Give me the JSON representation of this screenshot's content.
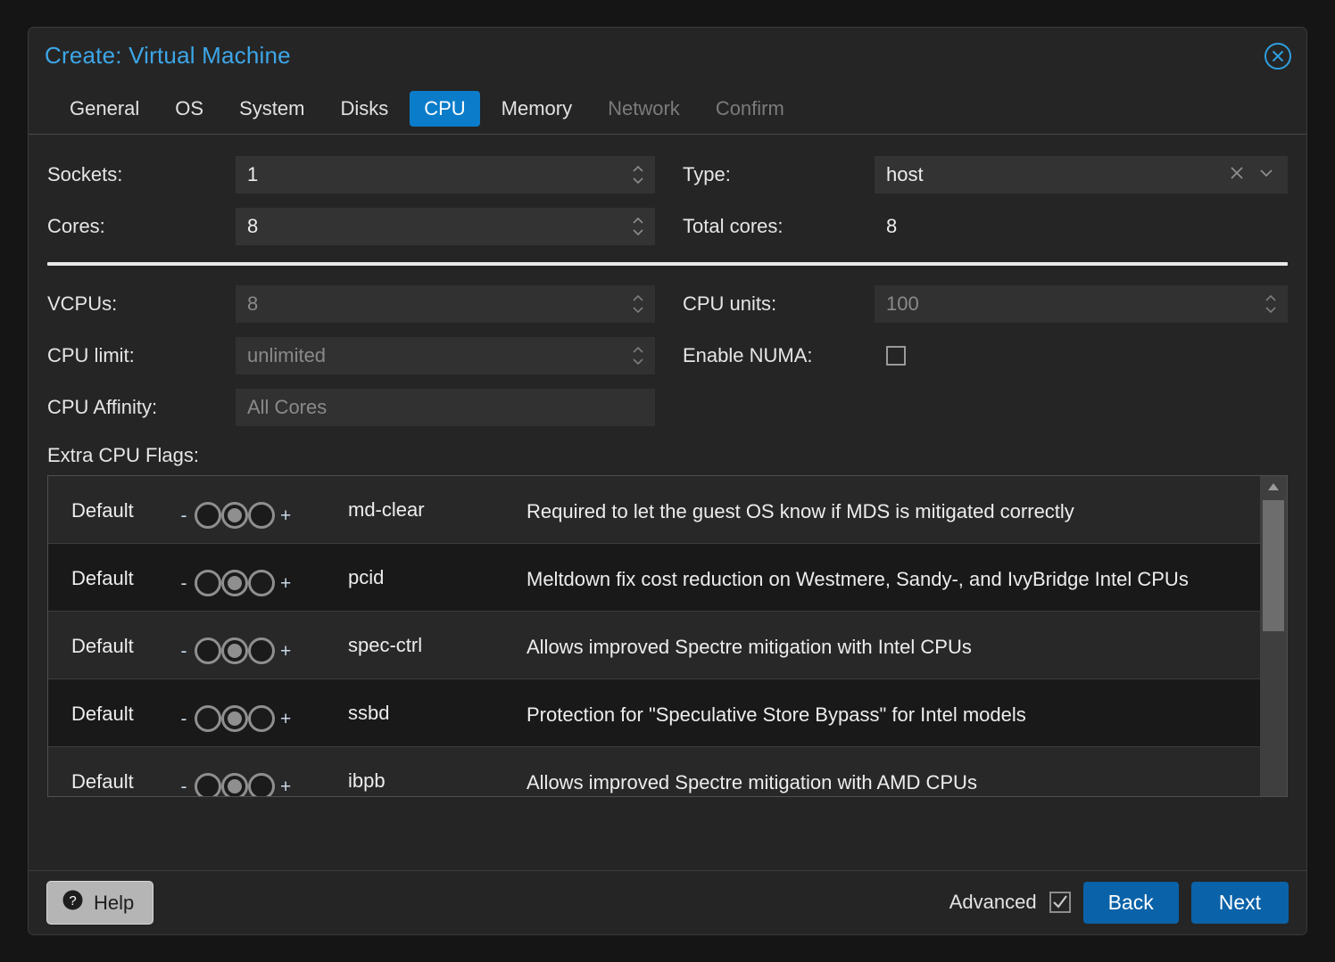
{
  "window": {
    "title": "Create: Virtual Machine",
    "close_icon": "close-circle-icon",
    "accent_blue": "#3da6e8",
    "tab_active_blue": "#0a7cca",
    "button_blue": "#0a62a8"
  },
  "tabs": [
    {
      "label": "General",
      "state": "enabled"
    },
    {
      "label": "OS",
      "state": "enabled"
    },
    {
      "label": "System",
      "state": "enabled"
    },
    {
      "label": "Disks",
      "state": "enabled"
    },
    {
      "label": "CPU",
      "state": "active"
    },
    {
      "label": "Memory",
      "state": "enabled"
    },
    {
      "label": "Network",
      "state": "disabled"
    },
    {
      "label": "Confirm",
      "state": "disabled"
    }
  ],
  "form": {
    "basic": {
      "sockets": {
        "label": "Sockets:",
        "value": "1",
        "spinner_icon": "spinner-up-down-icon"
      },
      "cores": {
        "label": "Cores:",
        "value": "8",
        "spinner_icon": "spinner-up-down-icon"
      },
      "type": {
        "label": "Type:",
        "value": "host",
        "clear_icon": "clear-x-icon",
        "expand_icon": "chevron-down-icon"
      },
      "total_cores": {
        "label": "Total cores:",
        "value": "8"
      }
    },
    "advanced": {
      "vcpus": {
        "label": "VCPUs:",
        "placeholder": "8",
        "spinner_icon": "spinner-up-down-icon"
      },
      "cpu_limit": {
        "label": "CPU limit:",
        "placeholder": "unlimited",
        "spinner_icon": "spinner-up-down-icon"
      },
      "cpu_affinity": {
        "label": "CPU Affinity:",
        "placeholder": "All Cores"
      },
      "cpu_units": {
        "label": "CPU units:",
        "placeholder": "100",
        "spinner_icon": "spinner-up-down-icon"
      },
      "enable_numa": {
        "label": "Enable NUMA:",
        "checked": false,
        "checkbox_icon": "checkbox-unchecked-icon"
      }
    }
  },
  "extra_cpu_flags": {
    "label": "Extra CPU Flags:",
    "minus_sign": "-",
    "plus_sign": "+",
    "rows": [
      {
        "state_label": "Default",
        "selected": "default",
        "flag": "md-clear",
        "description": "Required to let the guest OS know if MDS is mitigated correctly"
      },
      {
        "state_label": "Default",
        "selected": "default",
        "flag": "pcid",
        "description": "Meltdown fix cost reduction on Westmere, Sandy-, and IvyBridge Intel CPUs"
      },
      {
        "state_label": "Default",
        "selected": "default",
        "flag": "spec-ctrl",
        "description": "Allows improved Spectre mitigation with Intel CPUs"
      },
      {
        "state_label": "Default",
        "selected": "default",
        "flag": "ssbd",
        "description": "Protection for \"Speculative Store Bypass\" for Intel models"
      },
      {
        "state_label": "Default",
        "selected": "default",
        "flag": "ibpb",
        "description": "Allows improved Spectre mitigation with AMD CPUs"
      }
    ],
    "scrollbar": {
      "up_arrow_icon": "scroll-up-arrow-icon",
      "thumb_label": "scrollbar-thumb"
    }
  },
  "footer": {
    "help_label": "Help",
    "help_icon": "question-mark-circle-icon",
    "advanced_label": "Advanced",
    "advanced_checked": true,
    "advanced_checkbox_icon": "checkbox-checked-icon",
    "back_label": "Back",
    "next_label": "Next"
  }
}
